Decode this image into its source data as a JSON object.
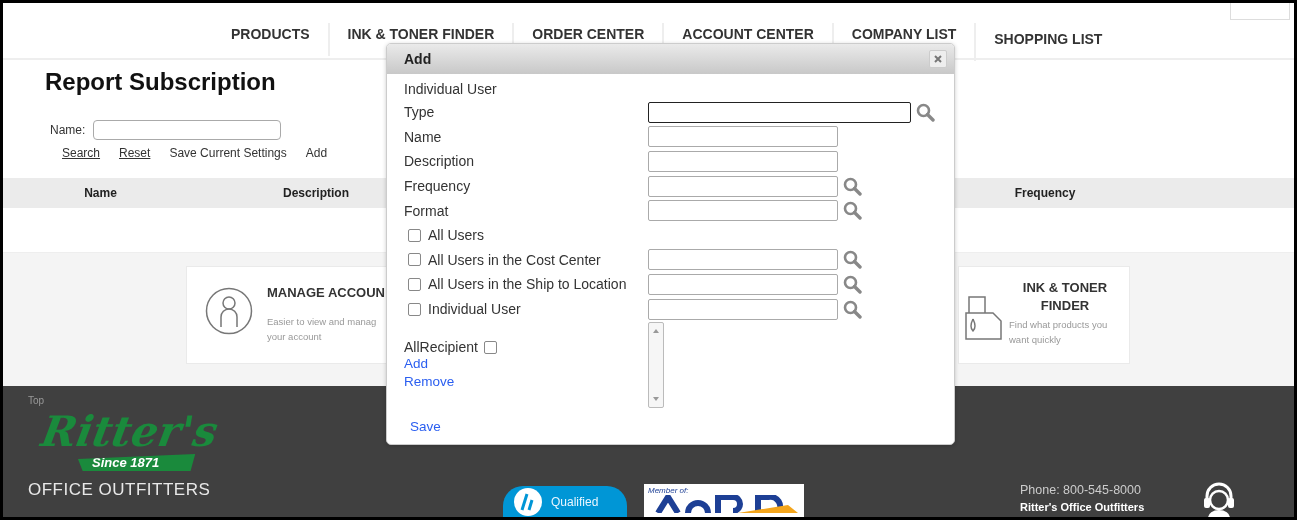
{
  "nav": {
    "items": [
      {
        "label": "PRODUCTS"
      },
      {
        "label": "INK & TONER FINDER"
      },
      {
        "label": "ORDER CENTER"
      },
      {
        "label": "ACCOUNT CENTER"
      },
      {
        "label": "COMPANY LIST"
      },
      {
        "label": "SHOPPING LIST"
      }
    ]
  },
  "page": {
    "title": "Report Subscription",
    "filter_label": "Name:",
    "actions": [
      {
        "label": "Search",
        "kind": "link"
      },
      {
        "label": "Reset",
        "kind": "link"
      },
      {
        "label": "Save Current Settings",
        "kind": "text"
      },
      {
        "label": "Add",
        "kind": "text"
      }
    ]
  },
  "table": {
    "columns": [
      "Name",
      "Description",
      "Frequency"
    ]
  },
  "cards": [
    {
      "title": "MANAGE ACCOUN",
      "description_lines": [
        "Easier to view and manag",
        "your account"
      ],
      "kind": "person"
    },
    {
      "title": "INK & TONER FINDER",
      "description_lines": [
        "Find what products you",
        "want quickly"
      ],
      "kind": "printer"
    }
  ],
  "footer": {
    "top_link": "Top",
    "logo_script": "Ritter's",
    "logo_tagline": "Since 1871",
    "logo_name": "OFFICE OUTFITTERS",
    "badge_text": "Qualified",
    "member_text": "Member of:",
    "phone": "Phone: 800-545-8000",
    "company": "Ritter's Office Outfitters"
  },
  "dialog": {
    "title": "Add",
    "section_label": "Individual User",
    "rows": [
      {
        "kind": "field",
        "label": "Type",
        "lookup": true,
        "focused": true
      },
      {
        "kind": "field",
        "label": "Name",
        "lookup": false,
        "focused": false
      },
      {
        "kind": "field",
        "label": "Description",
        "lookup": false,
        "focused": false
      },
      {
        "kind": "field",
        "label": "Frequency",
        "lookup": true,
        "focused": false
      },
      {
        "kind": "field",
        "label": "Format",
        "lookup": true,
        "focused": false
      },
      {
        "kind": "checkbox",
        "label": "All Users",
        "checked": false,
        "has_field": false
      },
      {
        "kind": "checkbox",
        "label": "All Users in the Cost Center",
        "checked": false,
        "has_field": true
      },
      {
        "kind": "checkbox",
        "label": "All Users in the Ship to Location",
        "checked": false,
        "has_field": true
      },
      {
        "kind": "checkbox",
        "label": "Individual User",
        "checked": false,
        "has_field": true
      }
    ],
    "recipient": {
      "label": "AllRecipient",
      "checked": false
    },
    "links": [
      "Add",
      "Remove"
    ],
    "save": "Save"
  }
}
